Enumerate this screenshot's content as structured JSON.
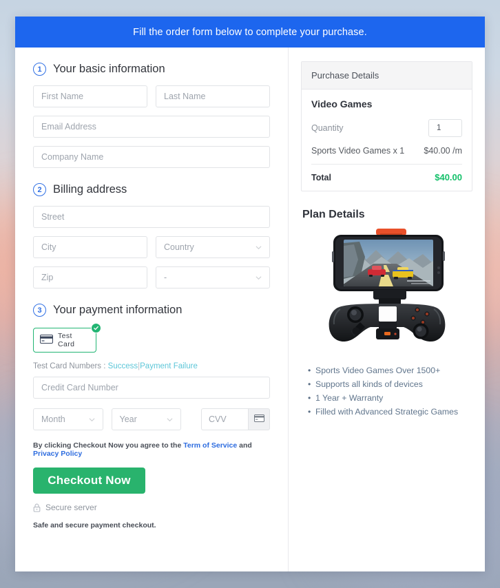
{
  "banner": {
    "text": "Fill the order form below to complete your purchase."
  },
  "steps": {
    "basic": {
      "num": "1",
      "title": "Your basic information"
    },
    "billing": {
      "num": "2",
      "title": "Billing address"
    },
    "payment": {
      "num": "3",
      "title": "Your payment information"
    }
  },
  "basic_fields": {
    "first_name": "First Name",
    "last_name": "Last Name",
    "email": "Email Address",
    "company": "Company Name"
  },
  "billing_fields": {
    "street": "Street",
    "city": "City",
    "country": "Country",
    "zip": "Zip",
    "state": "-"
  },
  "payment": {
    "method_label": "Test Card",
    "method_icon": "credit-card-icon",
    "selected_badge": "check-icon",
    "test_prefix": "Test Card Numbers :",
    "test_success": "Success",
    "test_separator": "|",
    "test_failure": "Payment Failure",
    "card_number": "Credit Card Number",
    "month": "Month",
    "year": "Year",
    "cvv": "CVV",
    "cvv_icon": "credit-card-icon"
  },
  "footer": {
    "agree_prefix": "By clicking Checkout Now you agree to the",
    "terms_link": "Term of Service",
    "agree_and": "and",
    "privacy_link": "Privacy Policy",
    "checkout_label": "Checkout Now",
    "secure_text": "Secure server",
    "secure_icon": "lock-icon",
    "safe_note": "Safe and secure payment checkout."
  },
  "purchase": {
    "header": "Purchase Details",
    "product_title": "Video Games",
    "quantity_label": "Quantity",
    "quantity_value": "1",
    "line_item": "Sports Video Games x 1",
    "line_price": "$40.00 /m",
    "total_label": "Total",
    "total_value": "$40.00"
  },
  "plan": {
    "title": "Plan Details",
    "image_alt": "smartphone-mounted-game-controller",
    "features": [
      "Sports Video Games Over 1500+",
      "Supports all kinds of devices",
      "1 Year + Warranty",
      "Filled with Advanced Strategic Games"
    ]
  },
  "colors": {
    "banner_blue": "#1d66ee",
    "accent_green": "#29b36d",
    "total_green": "#14c06a",
    "step_blue": "#2f6fe4",
    "link_blue": "#2d6cdf",
    "link_teal": "#5cc6d8"
  }
}
